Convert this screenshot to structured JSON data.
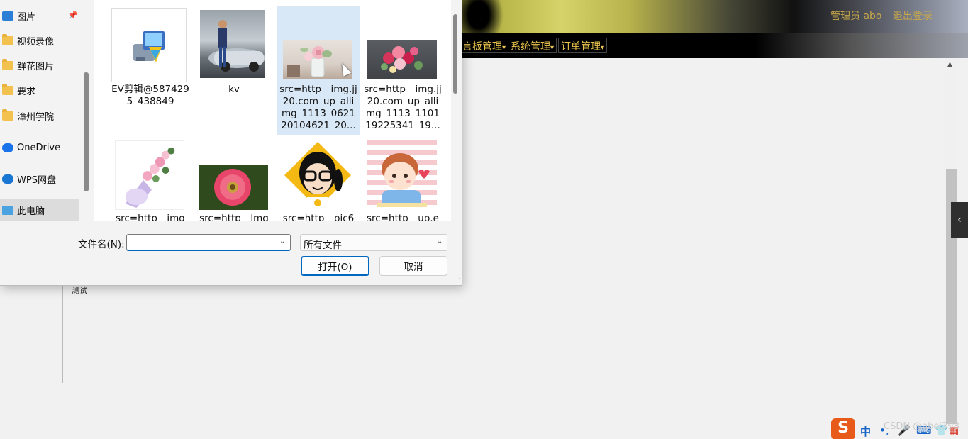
{
  "web": {
    "header": {
      "admin_label": "管理员 abo",
      "logout_label": "退出登录"
    },
    "nav": [
      {
        "label": "言板管理"
      },
      {
        "label": "系统管理"
      },
      {
        "label": "订单管理"
      }
    ],
    "caret": "▾",
    "body_text": "测试",
    "scroll_up": "▲",
    "side_toggle": "‹"
  },
  "dialog": {
    "nav_items": [
      {
        "label": "图片",
        "icon": "pictures-icon"
      },
      {
        "label": "视频录像",
        "icon": "folder-icon"
      },
      {
        "label": "鲜花图片",
        "icon": "folder-icon"
      },
      {
        "label": "要求",
        "icon": "folder-icon"
      },
      {
        "label": "漳州学院",
        "icon": "folder-icon"
      },
      {
        "label": "OneDrive",
        "icon": "onedrive-icon"
      },
      {
        "label": "WPS网盘",
        "icon": "wps-cloud-icon"
      },
      {
        "label": "此电脑",
        "icon": "this-pc-icon"
      }
    ],
    "pin_glyph": "📌",
    "files": [
      {
        "label": "EV剪辑@5874295_438849",
        "thumb": "installer-icon"
      },
      {
        "label": "kv",
        "thumb": "person-car-photo"
      },
      {
        "label": "src=http__img.jj20.com_up_allimg_1113_062120104621_20...",
        "thumb": "rose-vase-photo",
        "selected": true
      },
      {
        "label": "src=http__img.jj20.com_up_allimg_1113_110119225341_19...",
        "thumb": "bouquet-photo"
      },
      {
        "label": "src=http__img",
        "thumb": "pink-bouquet-photo"
      },
      {
        "label": "src=http__lmg",
        "thumb": "gerbera-photo"
      },
      {
        "label": "src=http__pic6",
        "thumb": "cartoon-girl-avatar"
      },
      {
        "label": "src=http__up.e",
        "thumb": "cartoon-boy-avatar"
      }
    ],
    "filename_label": "文件名(N):",
    "filename_value": "",
    "filetype_value": "所有文件",
    "open_label": "打开(O)",
    "cancel_label": "取消",
    "dropdown_glyph": "⌄"
  },
  "ime": {
    "logo": "S",
    "mode": "中",
    "punct": "•,",
    "mic": "🎤",
    "keyboard": "⌨",
    "skin": "👕",
    "tools": "▦"
  },
  "watermark": "CSDN @abei398"
}
